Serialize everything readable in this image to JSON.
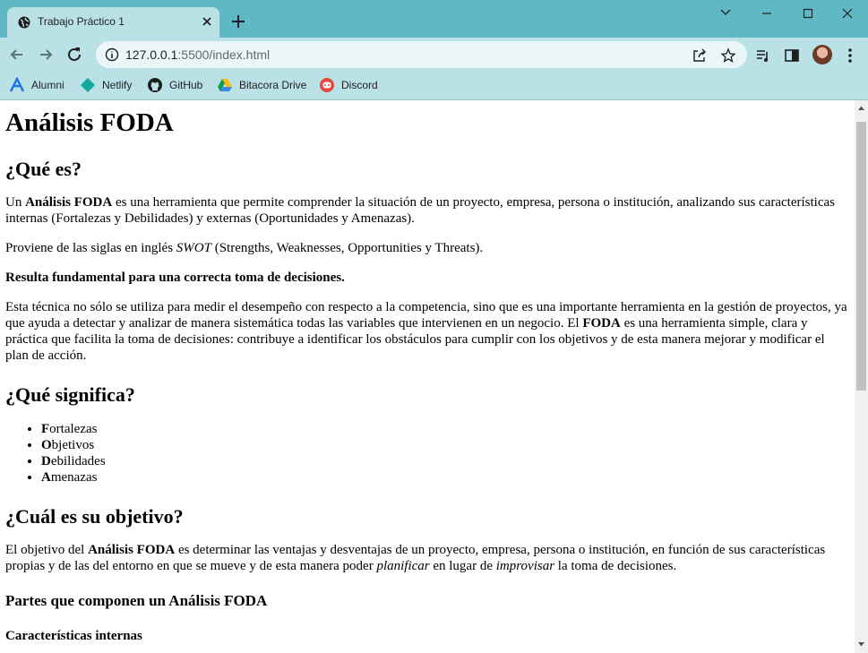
{
  "browser": {
    "tab_title": "Trabajo Práctico 1",
    "url_host": "127.0.0.1",
    "url_rest": ":5500/index.html",
    "bookmarks": [
      "Alumni",
      "Netlify",
      "GitHub",
      "Bitacora Drive",
      "Discord"
    ]
  },
  "page": {
    "h1": "Análisis FODA",
    "s1_title": "¿Qué es?",
    "p1": {
      "a": "Un ",
      "b": "Análisis FODA",
      "c": " es una herramienta que permite comprender la situación de un proyecto, empresa, persona o institución, analizando sus características internas (Fortalezas y Debilidades) y externas (Oportunidades y Amenazas)."
    },
    "p2": {
      "a": "Proviene de las siglas en inglés ",
      "b": "SWOT",
      "c": " (Strengths, Weaknesses, Opportunities y Threats)."
    },
    "p3": "Resulta fundamental para una correcta toma de decisiones.",
    "p4": {
      "a": "Esta técnica no sólo se utiliza para medir el desempeño con respecto a la competencia, sino que es una importante herramienta en la gestión de proyectos, ya que ayuda a detectar y analizar de manera sistemática todas las variables que intervienen en un negocio. El ",
      "b": "FODA",
      "c": " es una herramienta simple, clara y práctica que facilita la toma de decisiones: contribuye a identificar los obstáculos para cumplir con los objetivos y de esta manera mejorar y modificar el plan de acción."
    },
    "s2_title": "¿Qué significa?",
    "list": [
      {
        "initial": "F",
        "rest": "ortalezas"
      },
      {
        "initial": "O",
        "rest": "bjetivos"
      },
      {
        "initial": "D",
        "rest": "ebilidades"
      },
      {
        "initial": "A",
        "rest": "menazas"
      }
    ],
    "s3_title": "¿Cuál es su objetivo?",
    "p5": {
      "a": "El objetivo del ",
      "b": "Análisis FODA",
      "c": " es determinar las ventajas y desventajas de un proyecto, empresa, persona o institución, en función de sus características propias y de las del entorno en que se mueve y de esta manera poder ",
      "d": "planificar",
      "e": " en lugar de ",
      "f": "improvisar",
      "g": " la toma de decisiones."
    },
    "s4_title": "Partes que componen un Análisis FODA",
    "s5_title": "Características internas"
  }
}
